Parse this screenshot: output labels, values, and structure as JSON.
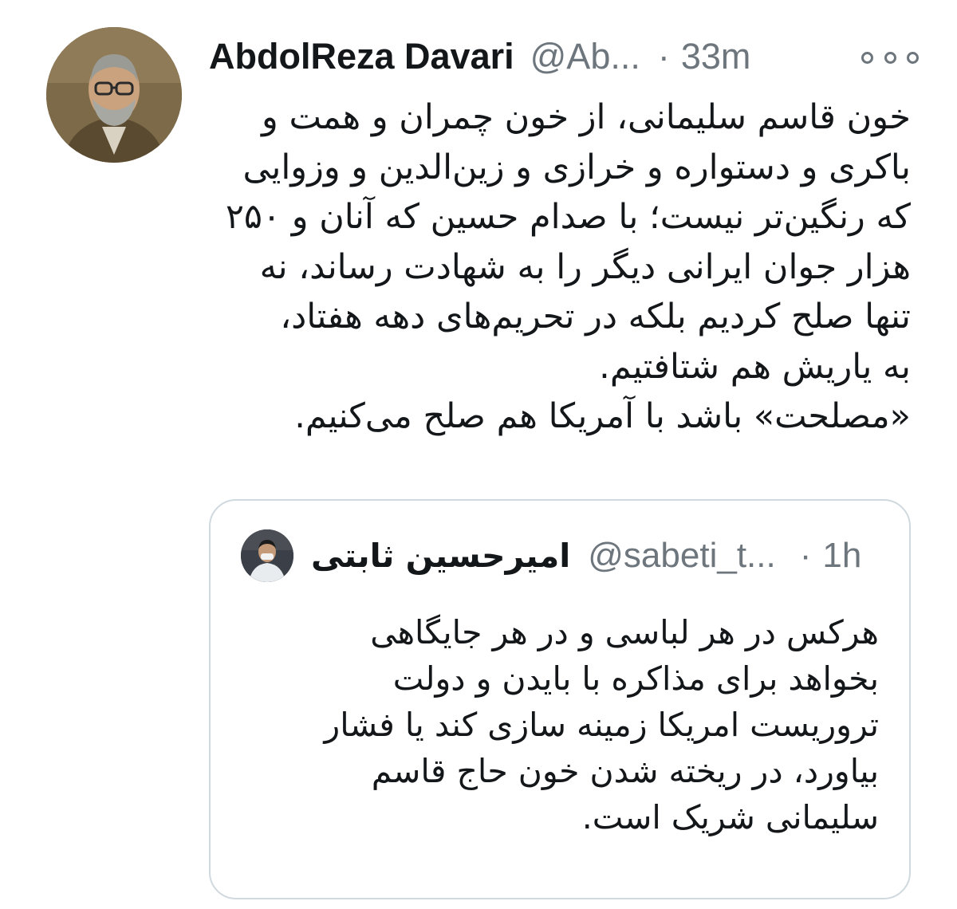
{
  "tweet": {
    "author": {
      "display_name": "AbdolReza Davari",
      "handle": "@Ab...",
      "avatar": "author-avatar-photo"
    },
    "separator": "·",
    "time": "33m",
    "more_icon": "more-options-icon",
    "body_lines": [
      "خون قاسم سلیمانی، از خون چمران و همت و",
      "باکری و دستواره و خرازی و زین‌الدین و وزوایی",
      "که رنگین‌تر نیست؛ با صدام حسین که آنان و ۲۵۰",
      " هزار جوان ایرانی دیگر را به شهادت رساند، نه",
      "تنها صلح کردیم بلکه در تحریم‌های دهه هفتاد،",
      "به یاریش هم شتافتیم.",
      "«مصلحت» باشد با آمریکا هم صلح می‌کنیم."
    ]
  },
  "quoted_tweet": {
    "author": {
      "display_name": "امیرحسین ثابتی",
      "handle": "@sabeti_t...",
      "avatar": "quoted-author-avatar-photo"
    },
    "separator": "·",
    "time": "1h",
    "body_lines": [
      "هرکس در هر لباسی و در هر جایگاهی",
      "بخواهد برای مذاکره با بایدن و دولت",
      "تروریست امریکا زمینه سازی کند یا فشار",
      "بیاورد، در ریخته شدن خون حاج قاسم",
      "سلیمانی شریک است."
    ]
  },
  "colors": {
    "text_primary": "#14171a",
    "text_secondary": "#6e767d",
    "card_border": "#cfd9de",
    "background": "#ffffff"
  }
}
